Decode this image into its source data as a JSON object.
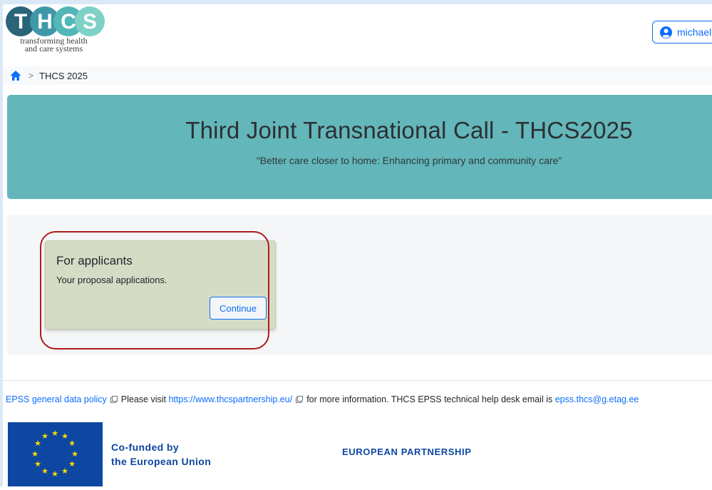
{
  "header": {
    "logo_letters": "THCS",
    "logo_subtitle_line1": "transforming health",
    "logo_subtitle_line2": "and care systems",
    "user_label": "michael"
  },
  "breadcrumb": {
    "current": "THCS 2025",
    "separator": ">"
  },
  "hero": {
    "title": "Third Joint Transnational Call - THCS2025",
    "subtitle": "\"Better care closer to home: Enhancing primary and community care\""
  },
  "card": {
    "title": "For applicants",
    "text": "Your proposal applications.",
    "button_label": "Continue"
  },
  "footer": {
    "policy_link": "EPSS general data policy",
    "visit_text": "Please visit",
    "website_link": "https://www.thcspartnership.eu/",
    "info_text": "for more information. THCS EPSS technical help desk email is",
    "email_link": "epss.thcs@g.etag.ee",
    "cofunded_line1": "Co-funded by",
    "cofunded_line2": "the European Union",
    "partnership": "EUROPEAN PARTNERSHIP"
  },
  "colors": {
    "hero_bg": "#63b6b9",
    "card_bg": "#d5dcc6",
    "accent": "#0d6efd",
    "highlight": "#b01a1a",
    "eu_blue": "#0e47a1"
  }
}
